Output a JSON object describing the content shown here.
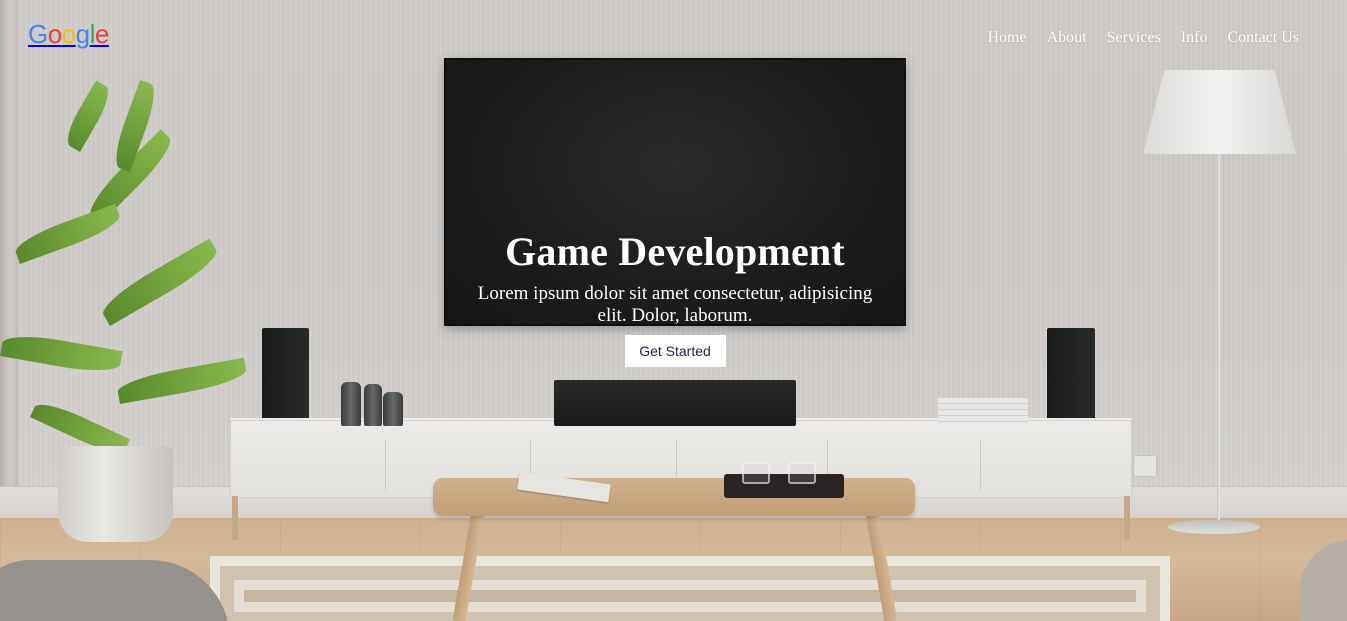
{
  "brand": {
    "logo_letters": [
      "G",
      "o",
      "o",
      "g",
      "l",
      "e"
    ],
    "logo_colors": [
      "#4285F4",
      "#EA4335",
      "#FBBC05",
      "#4285F4",
      "#34A853",
      "#EA4335"
    ]
  },
  "nav": {
    "items": [
      {
        "label": "Home"
      },
      {
        "label": "About"
      },
      {
        "label": "Services"
      },
      {
        "label": "Info"
      },
      {
        "label": "Contact Us"
      }
    ]
  },
  "hero": {
    "title": "Game Development",
    "description": "Lorem ipsum dolor sit amet consectetur, adipisicing elit. Dolor, laborum.",
    "cta_label": "Get Started"
  },
  "colors": {
    "text_on_image": "#ffffff",
    "cta_background": "#ffffff",
    "cta_text": "#2b1e4a"
  }
}
